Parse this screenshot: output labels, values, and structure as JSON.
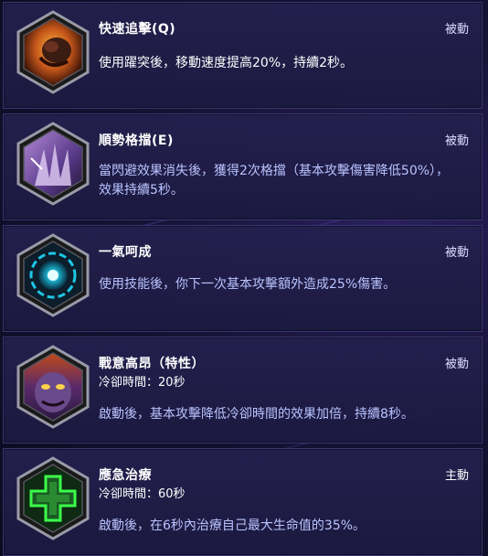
{
  "talents": [
    {
      "title": "快速追擊(Q)",
      "type": "被動",
      "description": "使用躍突後，移動速度提高20%，持續2秒。",
      "icon": "beast-charge-icon"
    },
    {
      "title": "順勢格擋(E)",
      "type": "被動",
      "description": "當閃避效果消失後，獲得2次格擋（基本攻擊傷害降低50%），效果持續5秒。",
      "icon": "demon-claw-icon"
    },
    {
      "title": "一氣呵成",
      "type": "被動",
      "description": "使用技能後，你下一次基本攻擊額外造成25%傷害。",
      "icon": "energy-core-icon"
    },
    {
      "title": "戰意高昂（特性）",
      "cooldown": "冷卻時間：20秒",
      "type": "被動",
      "description": "啟動後，基本攻擊降低冷卻時間的效果加倍，持續8秒。",
      "icon": "demon-face-icon"
    },
    {
      "title": "應急治療",
      "cooldown": "冷卻時間：60秒",
      "type": "主動",
      "description": "啟動後，在6秒內治療自己最大生命值的35%。",
      "icon": "heal-cross-icon"
    }
  ],
  "colors": {
    "card_bg": "#241f4e",
    "card_border": "#3a3572",
    "description_blue": "#b9c4ff",
    "heal_green": "#3bff4a"
  }
}
